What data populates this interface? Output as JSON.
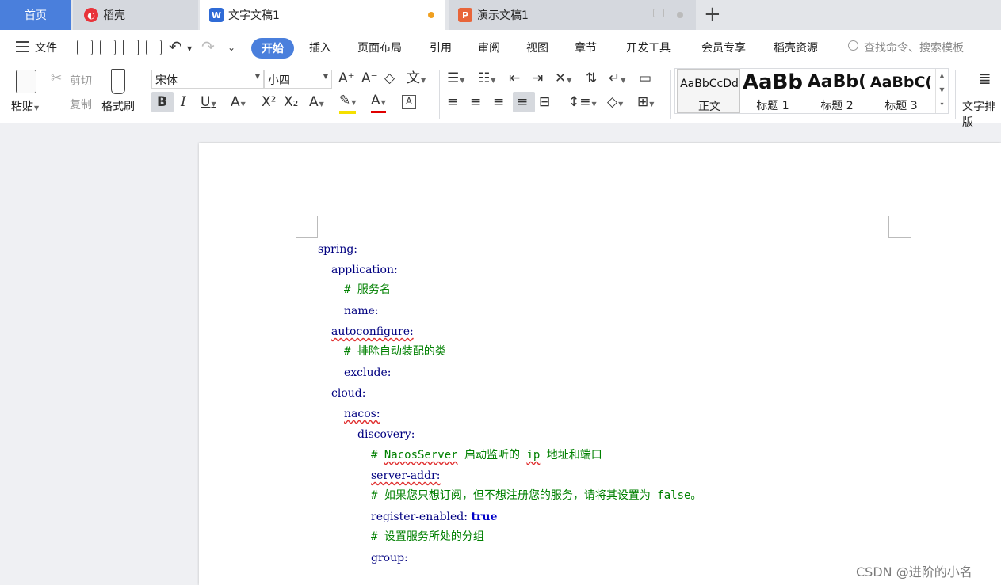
{
  "tabs": {
    "home": "首页",
    "daoke": "稻壳",
    "doc": "文字文稿1",
    "ppt": "演示文稿1"
  },
  "menu": {
    "file": "文件",
    "items": [
      "开始",
      "插入",
      "页面布局",
      "引用",
      "审阅",
      "视图",
      "章节",
      "开发工具",
      "会员专享",
      "稻壳资源"
    ],
    "search_placeholder": "查找命令、搜索模板"
  },
  "ribbon": {
    "paste": "粘贴",
    "cut": "剪切",
    "copy": "复制",
    "format_painter": "格式刷",
    "font_name": "宋体",
    "font_size": "小四",
    "styles": [
      {
        "preview": "AaBbCcDd",
        "name": "正文"
      },
      {
        "preview": "AaBb",
        "name": "标题 1"
      },
      {
        "preview": "AaBb(",
        "name": "标题 2"
      },
      {
        "preview": "AaBbC(",
        "name": "标题 3"
      }
    ],
    "text_layout": "文字排版"
  },
  "doc_lines": [
    {
      "key": "spring:"
    },
    {
      "key": "application:"
    },
    {
      "comment": "# 服务名"
    },
    {
      "key": "name:"
    },
    {
      "key": "autoconfigure:"
    },
    {
      "comment": "# 排除自动装配的类"
    },
    {
      "key": "exclude:"
    },
    {
      "key": "cloud:"
    },
    {
      "key": "nacos:"
    },
    {
      "key": "discovery:"
    },
    {
      "comment_a": "# ",
      "comment_b": "NacosServer",
      "comment_c": " 启动监听的 ",
      "comment_d": "ip",
      "comment_e": " 地址和端口"
    },
    {
      "key": "server-addr:"
    },
    {
      "comment": "# 如果您只想订阅，但不想注册您的服务，请将其设置为 false。"
    },
    {
      "key": "register-enabled:",
      "value": "true"
    },
    {
      "comment": "# 设置服务所处的分组"
    },
    {
      "key": "group:"
    }
  ],
  "watermark": "CSDN @进阶的小名"
}
